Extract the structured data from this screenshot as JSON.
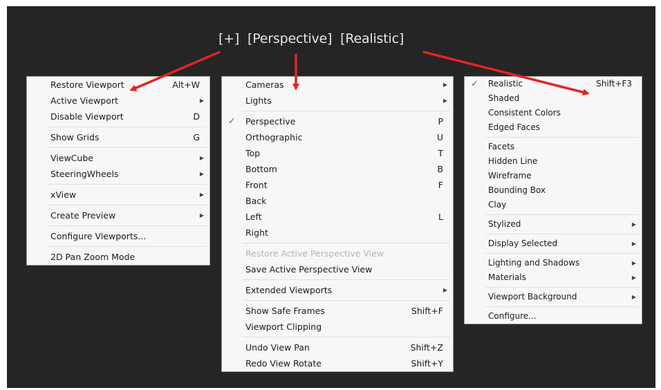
{
  "header": {
    "plus": "[+]",
    "perspective": "[Perspective]",
    "realistic": "[Realistic]"
  },
  "colors": {
    "background": "#252525",
    "menu_bg": "#f7f7f7",
    "arrow": "#e2241f",
    "check": "#3d6fb6"
  },
  "menu_a": {
    "items": [
      {
        "label": "Restore Viewport",
        "shortcut": "Alt+W"
      },
      {
        "label": "Active Viewport",
        "submenu": true
      },
      {
        "label": "Disable Viewport",
        "shortcut": "D"
      },
      {
        "label": "Show Grids",
        "shortcut": "G"
      },
      {
        "label": "ViewCube",
        "submenu": true
      },
      {
        "label": "SteeringWheels",
        "submenu": true
      },
      {
        "label": "xView",
        "submenu": true
      },
      {
        "label": "Create Preview",
        "submenu": true
      },
      {
        "label": "Configure Viewports..."
      },
      {
        "label": "2D Pan Zoom Mode"
      }
    ]
  },
  "menu_b": {
    "items": [
      {
        "label": "Cameras",
        "submenu": true
      },
      {
        "label": "Lights",
        "submenu": true
      },
      {
        "label": "Perspective",
        "shortcut": "P",
        "checked": true
      },
      {
        "label": "Orthographic",
        "shortcut": "U"
      },
      {
        "label": "Top",
        "shortcut": "T"
      },
      {
        "label": "Bottom",
        "shortcut": "B"
      },
      {
        "label": "Front",
        "shortcut": "F"
      },
      {
        "label": "Back"
      },
      {
        "label": "Left",
        "shortcut": "L"
      },
      {
        "label": "Right"
      },
      {
        "label": "Restore Active Perspective View",
        "disabled": true
      },
      {
        "label": "Save Active Perspective View"
      },
      {
        "label": "Extended Viewports",
        "submenu": true
      },
      {
        "label": "Show Safe Frames",
        "shortcut": "Shift+F"
      },
      {
        "label": "Viewport Clipping"
      },
      {
        "label": "Undo View Pan",
        "shortcut": "Shift+Z"
      },
      {
        "label": "Redo View Rotate",
        "shortcut": "Shift+Y"
      }
    ]
  },
  "menu_c": {
    "items": [
      {
        "label": "Realistic",
        "shortcut": "Shift+F3",
        "checked": true
      },
      {
        "label": "Shaded"
      },
      {
        "label": "Consistent Colors"
      },
      {
        "label": "Edged Faces"
      },
      {
        "label": "Facets"
      },
      {
        "label": "Hidden Line"
      },
      {
        "label": "Wireframe"
      },
      {
        "label": "Bounding Box"
      },
      {
        "label": "Clay"
      },
      {
        "label": "Stylized",
        "submenu": true
      },
      {
        "label": "Display Selected",
        "submenu": true
      },
      {
        "label": "Lighting and Shadows",
        "submenu": true
      },
      {
        "label": "Materials",
        "submenu": true
      },
      {
        "label": "Viewport Background",
        "submenu": true
      },
      {
        "label": "Configure..."
      }
    ]
  }
}
